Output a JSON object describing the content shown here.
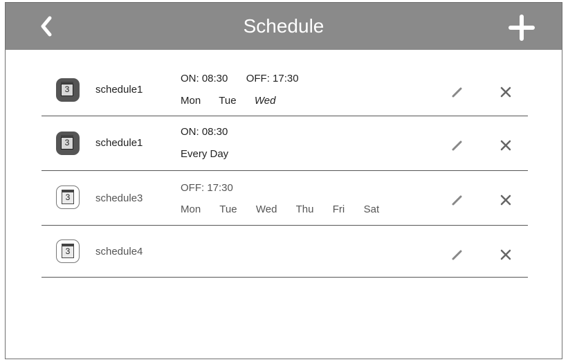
{
  "header": {
    "title": "Schedule",
    "back_icon": "chevron-left-icon",
    "add_icon": "plus-icon"
  },
  "schedules": [
    {
      "name": "schedule1",
      "enabled": true,
      "line1": [
        "ON: 08:30",
        "OFF: 17:30"
      ],
      "line2": [
        "Mon",
        "Tue",
        "Wed"
      ]
    },
    {
      "name": "schedule1",
      "enabled": true,
      "line1": [
        "ON: 08:30"
      ],
      "line2": [
        "Every Day"
      ]
    },
    {
      "name": "schedule3",
      "enabled": false,
      "line1": [
        "OFF: 17:30"
      ],
      "line2": [
        "Mon",
        "Tue",
        "Wed",
        "Thu",
        "Fri",
        "Sat"
      ]
    },
    {
      "name": "schedule4",
      "enabled": false,
      "line1": [],
      "line2": []
    }
  ],
  "calendar_day": "3",
  "icons": {
    "edit": "pencil-icon",
    "delete": "close-icon"
  },
  "colors": {
    "header": "#8a8a8a",
    "active_icon": "#555555"
  }
}
